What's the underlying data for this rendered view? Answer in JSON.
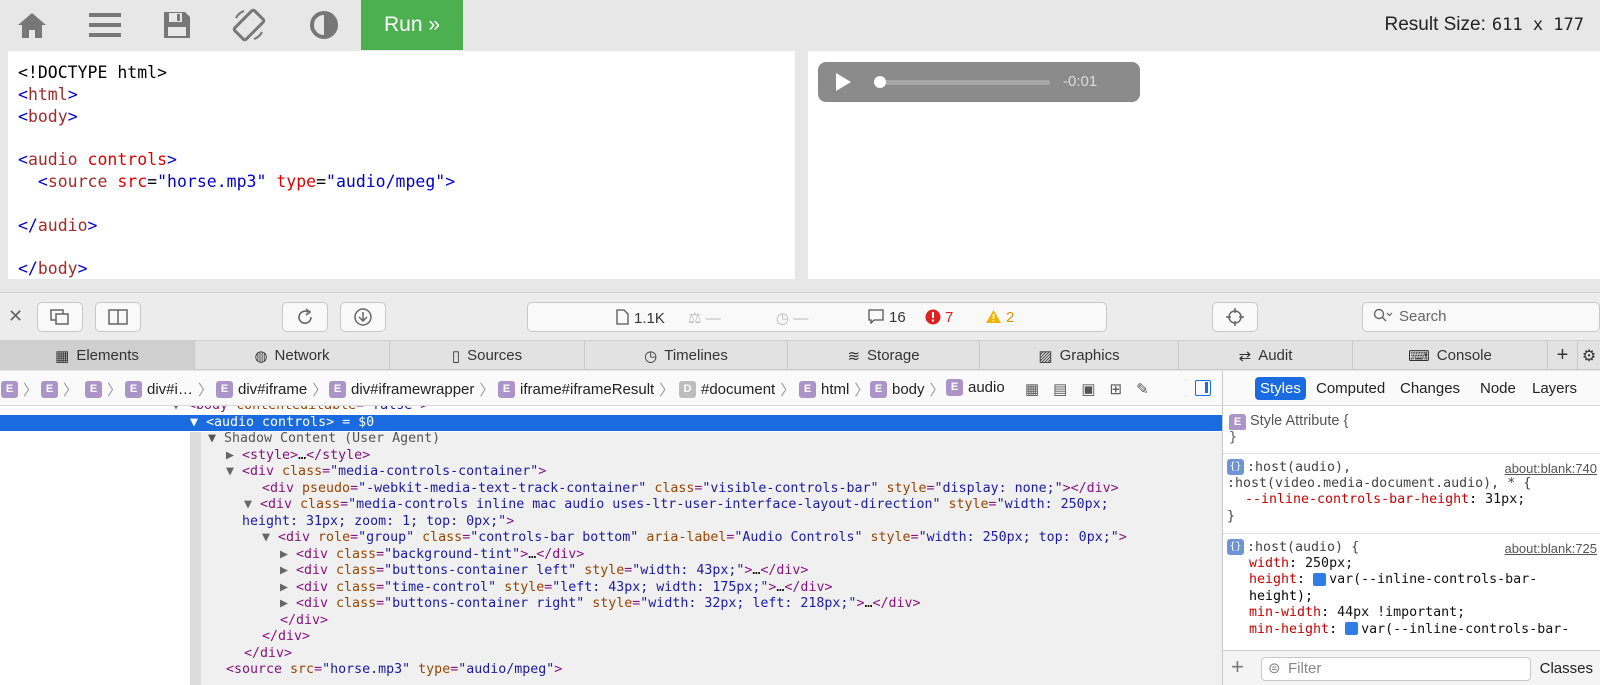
{
  "toolbar": {
    "icons": [
      "home-icon",
      "menu-icon",
      "save-icon",
      "rotate-icon",
      "contrast-icon"
    ],
    "run_label": "Run »",
    "result_size_label": "Result Size:",
    "result_size_value": "611 x 177"
  },
  "code": {
    "lines": [
      "<!DOCTYPE html>",
      "<html>",
      "<body>",
      "",
      "<audio controls>",
      "  <source src=\"horse.mp3\" type=\"audio/mpeg\">",
      "",
      "</audio>",
      "",
      "</body>"
    ]
  },
  "result": {
    "audio_time": "-0:01"
  },
  "devtools": {
    "status": {
      "resource_size": "1.1K",
      "load_placeholder": "—",
      "time_placeholder": "—",
      "log_count": "16",
      "error_count": "7",
      "warning_count": "2"
    },
    "search_placeholder": "Search",
    "tabs": [
      "Elements",
      "Network",
      "Sources",
      "Timelines",
      "Storage",
      "Graphics",
      "Audit",
      "Console"
    ],
    "breadcrumbs": [
      "",
      "",
      "",
      "div#i…",
      "div#iframe",
      "div#iframewrapper",
      "iframe#iframeResult",
      "#document",
      "html",
      "body",
      "audio"
    ],
    "sidebar_tabs": [
      "Styles",
      "Computed",
      "Changes",
      "Node",
      "Layers"
    ],
    "style_attribute_label": "Style Attribute",
    "rules": [
      {
        "source": "about:blank:740",
        "selector_1": ":host(audio),",
        "selector_2": ":host(video.media-document.audio), * {",
        "prop": "--inline-controls-bar-height",
        "value": "31px;"
      },
      {
        "source": "about:blank:725",
        "selector_1": ":host(audio) {",
        "width_prop": "width",
        "width_val": "250px;",
        "height_prop": "height",
        "height_val": "var(--inline-controls-bar-",
        "height_cont": "height);",
        "minw_prop": "min-width",
        "minw_val": "44px !important;",
        "minh_prop": "min-height",
        "minh_val": "var(--inline-controls-bar-"
      }
    ],
    "filter_placeholder": "Filter",
    "classes_label": "Classes"
  }
}
